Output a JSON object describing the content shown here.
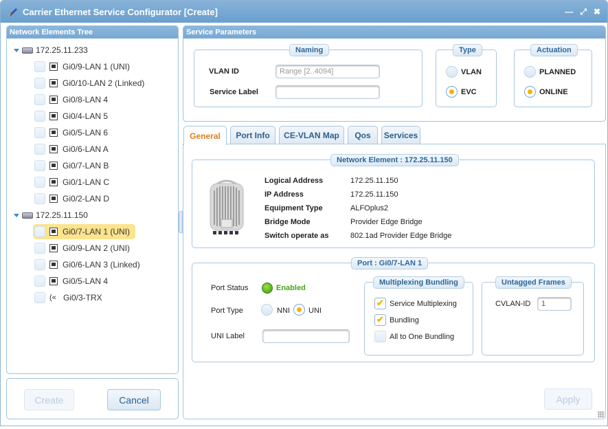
{
  "window": {
    "title": "Carrier Ethernet Service Configurator [Create]",
    "controls": {
      "minimize": "—",
      "restore": "⤢",
      "close": "✖"
    }
  },
  "tree": {
    "header": "Network Elements Tree",
    "nodes": [
      {
        "label": "172.25.11.233",
        "ports": [
          {
            "label": "Gi0/9-LAN 1 (UNI)",
            "icon": "ethernet-port-icon"
          },
          {
            "label": "Gi0/10-LAN 2 (Linked)",
            "icon": "ethernet-port-icon"
          },
          {
            "label": "Gi0/8-LAN 4",
            "icon": "ethernet-port-icon"
          },
          {
            "label": "Gi0/4-LAN 5",
            "icon": "ethernet-port-icon"
          },
          {
            "label": "Gi0/5-LAN 6",
            "icon": "ethernet-port-icon"
          },
          {
            "label": "Gi0/6-LAN A",
            "icon": "ethernet-port-icon"
          },
          {
            "label": "Gi0/7-LAN B",
            "icon": "ethernet-port-icon"
          },
          {
            "label": "Gi0/1-LAN C",
            "icon": "ethernet-port-icon"
          },
          {
            "label": "Gi0/2-LAN D",
            "icon": "ethernet-port-icon"
          }
        ]
      },
      {
        "label": "172.25.11.150",
        "ports": [
          {
            "label": "Gi0/7-LAN 1 (UNI)",
            "icon": "ethernet-port-icon",
            "selected": true
          },
          {
            "label": "Gi0/9-LAN 2 (UNI)",
            "icon": "ethernet-port-icon"
          },
          {
            "label": "Gi0/6-LAN 3 (Linked)",
            "icon": "ethernet-port-icon"
          },
          {
            "label": "Gi0/5-LAN 4",
            "icon": "ethernet-port-icon"
          },
          {
            "label": "Gi0/3-TRX",
            "icon": "radio-trx-icon"
          }
        ]
      }
    ]
  },
  "buttons": {
    "create": "Create",
    "cancel": "Cancel",
    "apply": "Apply"
  },
  "service": {
    "header": "Service Parameters",
    "naming": {
      "legend": "Naming",
      "vlan_id_label": "VLAN ID",
      "vlan_id_placeholder": "Range [2..4094]",
      "vlan_id_value": "",
      "service_label_label": "Service Label",
      "service_label_value": ""
    },
    "type": {
      "legend": "Type",
      "options": [
        "VLAN",
        "EVC"
      ],
      "selected": "EVC"
    },
    "actuation": {
      "legend": "Actuation",
      "options": [
        "PLANNED",
        "ONLINE"
      ],
      "selected": "ONLINE"
    }
  },
  "tabs": [
    {
      "label": "General",
      "active": true
    },
    {
      "label": "Port Info"
    },
    {
      "label": "CE-VLAN Map"
    },
    {
      "label": "Qos"
    },
    {
      "label": "Services"
    }
  ],
  "general": {
    "ne_legend": "Network Element : 172.25.11.150",
    "info": [
      {
        "label": "Logical Address",
        "value": "172.25.11.150"
      },
      {
        "label": "IP Address",
        "value": "172.25.11.150"
      },
      {
        "label": "Equipment Type",
        "value": "ALFOplus2"
      },
      {
        "label": "Bridge Mode",
        "value": "Provider Edge Bridge"
      },
      {
        "label": "Switch operate as",
        "value": "802.1ad Provider Edge Bridge"
      }
    ],
    "port_legend": "Port : Gi0/7-LAN 1",
    "port_status_label": "Port Status",
    "port_status_value": "Enabled",
    "port_status_color": "#4aa31a",
    "port_type_label": "Port Type",
    "port_type_options": [
      "NNI",
      "UNI"
    ],
    "port_type_selected": "UNI",
    "uni_label_label": "UNI Label",
    "uni_label_value": "",
    "mux": {
      "legend": "Multiplexing Bundling",
      "options": [
        {
          "label": "Service Multiplexing",
          "checked": true
        },
        {
          "label": "Bundling",
          "checked": true
        },
        {
          "label": "All to One Bundling",
          "checked": false
        }
      ]
    },
    "untagged": {
      "legend": "Untagged Frames",
      "cvlan_label": "CVLAN-ID",
      "cvlan_value": "1"
    }
  }
}
